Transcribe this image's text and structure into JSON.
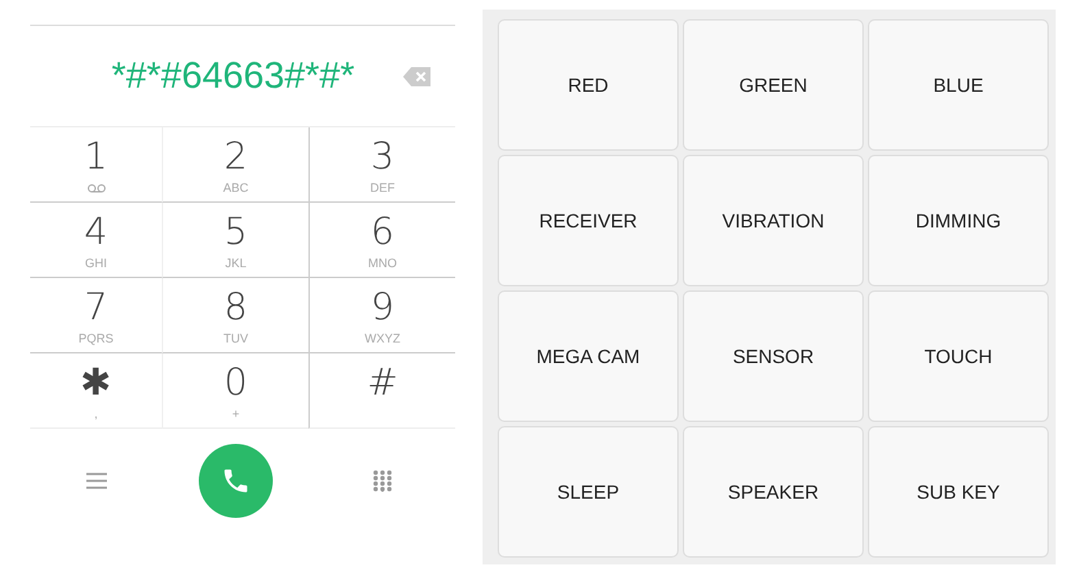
{
  "dialer": {
    "number": "*#*#64663#*#*",
    "keys": [
      {
        "digit": "1",
        "kind": "voicemail"
      },
      {
        "digit": "2",
        "kind": "letters",
        "sub": "ABC"
      },
      {
        "digit": "3",
        "kind": "letters",
        "sub": "DEF"
      },
      {
        "digit": "4",
        "kind": "letters",
        "sub": "GHI"
      },
      {
        "digit": "5",
        "kind": "letters",
        "sub": "JKL"
      },
      {
        "digit": "6",
        "kind": "letters",
        "sub": "MNO"
      },
      {
        "digit": "7",
        "kind": "letters",
        "sub": "PQRS"
      },
      {
        "digit": "8",
        "kind": "letters",
        "sub": "TUV"
      },
      {
        "digit": "9",
        "kind": "letters",
        "sub": "WXYZ"
      },
      {
        "digit": "✱",
        "kind": "letters",
        "sub": ","
      },
      {
        "digit": "0",
        "kind": "letters",
        "sub": "+"
      },
      {
        "digit": "#",
        "kind": "plain"
      }
    ]
  },
  "tests": [
    "RED",
    "GREEN",
    "BLUE",
    "RECEIVER",
    "VIBRATION",
    "DIMMING",
    "MEGA CAM",
    "SENSOR",
    "TOUCH",
    "SLEEP",
    "SPEAKER",
    "SUB KEY"
  ]
}
